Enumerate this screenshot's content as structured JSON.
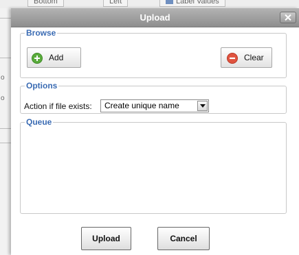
{
  "background": {
    "tabs": [
      "Bottom",
      "Left",
      "Label Values"
    ],
    "left_chars": [
      "o",
      "o"
    ]
  },
  "dialog": {
    "title": "Upload",
    "browse": {
      "legend": "Browse",
      "add_label": "Add",
      "clear_label": "Clear"
    },
    "options": {
      "legend": "Options",
      "action_label": "Action if file exists:",
      "action_value": "Create unique name"
    },
    "queue": {
      "legend": "Queue",
      "items": []
    },
    "upload_label": "Upload",
    "cancel_label": "Cancel"
  },
  "colors": {
    "legend": "#3a6bb3",
    "add_icon": "#5aab3c",
    "clear_icon": "#e0533f",
    "titlebar": "#9e9e9e"
  },
  "icons": {
    "close": "close-icon",
    "add": "plus-circle-icon",
    "clear": "minus-circle-icon",
    "dropdown": "triangle-down-icon"
  }
}
